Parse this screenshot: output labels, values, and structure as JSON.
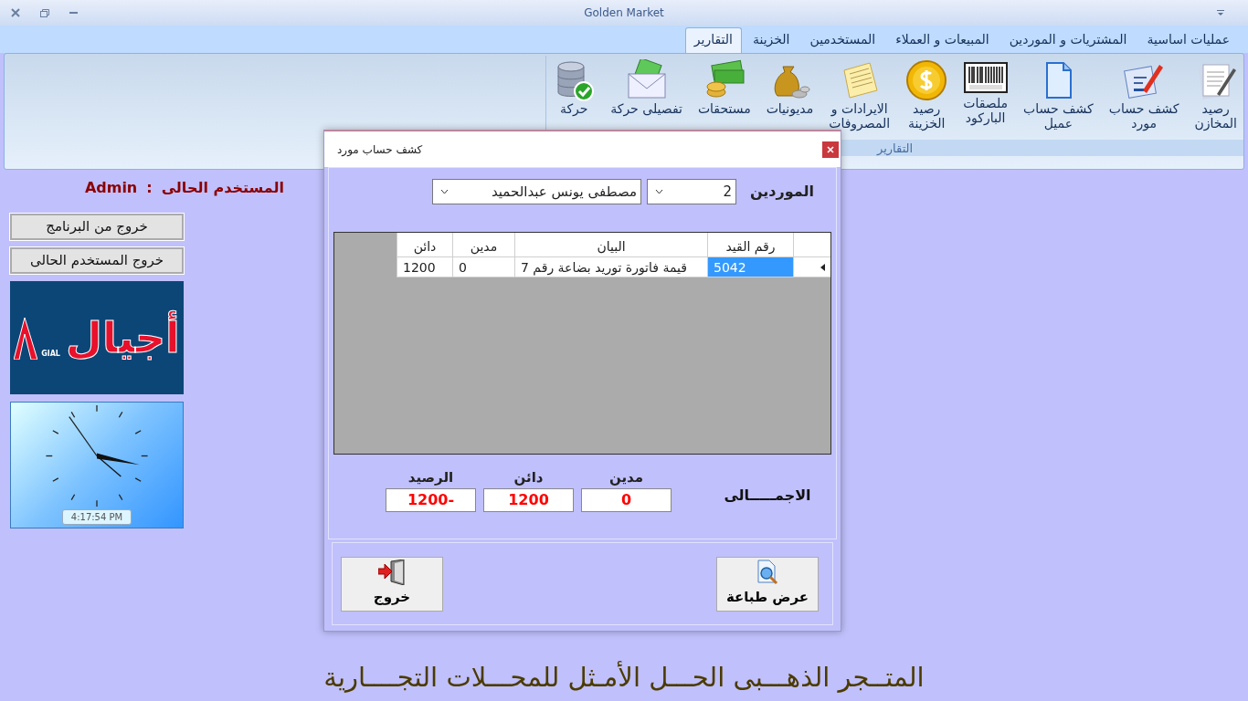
{
  "window": {
    "title": "Golden Market"
  },
  "tabs": [
    {
      "label": "عمليات اساسية",
      "selected": false
    },
    {
      "label": "المشتريات و الموردين",
      "selected": false
    },
    {
      "label": "المبيعات و العملاء",
      "selected": false
    },
    {
      "label": "المستخدمين",
      "selected": false
    },
    {
      "label": "الخزينة",
      "selected": false
    },
    {
      "label": "التقارير",
      "selected": true
    }
  ],
  "ribbon": {
    "group_label": "التقارير",
    "items": [
      {
        "lines": [
          "رصيد",
          "المخازن"
        ]
      },
      {
        "lines": [
          "كشف حساب",
          "مورد"
        ]
      },
      {
        "lines": [
          "كشف حساب",
          "عميل"
        ]
      },
      {
        "lines": [
          "ملصقات",
          "الباركود"
        ]
      },
      {
        "lines": [
          "رصيد",
          "الخزينة"
        ]
      },
      {
        "lines": [
          "الايرادات و",
          "المصروفات"
        ]
      },
      {
        "lines": [
          "مديونيات"
        ]
      },
      {
        "lines": [
          "مستحقات"
        ]
      },
      {
        "lines": [
          "تفصيلى حركة"
        ]
      },
      {
        "lines": [
          "حركة"
        ]
      }
    ]
  },
  "current_user": {
    "label": "المستخدم الحالى",
    "separator": ":",
    "value": "Admin"
  },
  "side_buttons": [
    "خروج من البرنامج",
    "خروج المستخدم الحالى"
  ],
  "logo": {
    "text": "أجيال",
    "subtext": "GIAL"
  },
  "clock": {
    "time": "4:17:54 PM"
  },
  "dialog": {
    "title": "كشف حساب مورد",
    "supplier_label": "الموردين",
    "supplier_code": "2",
    "supplier_name": "مصطفى يونس عبدالحميد",
    "table": {
      "columns": [
        "رقم القيد",
        "البيان",
        "مدين",
        "دائن"
      ],
      "rows": [
        {
          "cells": [
            "5042",
            "قيمة فاتورة توريد بضاعة رقم  7",
            "0",
            "1200"
          ],
          "selected": true
        }
      ]
    },
    "totals": {
      "label": "الاجمـــــالى",
      "fields": [
        {
          "label": "مدين",
          "value": "0"
        },
        {
          "label": "دائن",
          "value": "1200"
        },
        {
          "label": "الرصيد",
          "value": "1200-"
        }
      ]
    },
    "buttons": [
      {
        "label": "عرض طباعة"
      },
      {
        "label": "خروج"
      }
    ]
  },
  "footer": "المتــجر الذهـــبى الحـــل الأمـثل للمحـــلات التجــــارية"
}
